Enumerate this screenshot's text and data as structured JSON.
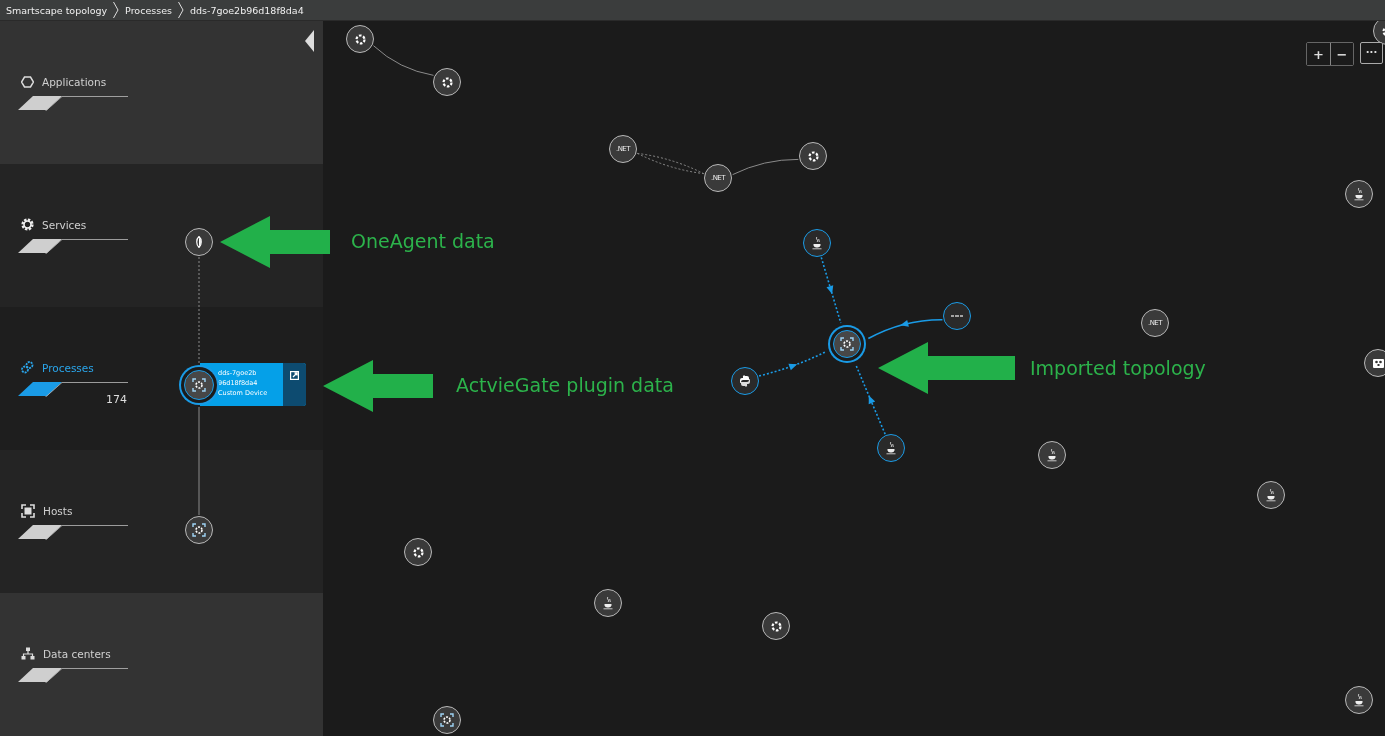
{
  "breadcrumbs": [
    "Smartscape topology",
    "Processes",
    "dds-7goe2b96d18f8da4"
  ],
  "sidebar": {
    "items": [
      {
        "label": "Applications",
        "kind": "hexagon",
        "selected": false
      },
      {
        "label": "Services",
        "kind": "gear",
        "selected": false
      },
      {
        "label": "Processes",
        "kind": "links",
        "selected": true,
        "count": "174"
      },
      {
        "label": "Hosts",
        "kind": "host",
        "selected": false
      },
      {
        "label": "Data centers",
        "kind": "network",
        "selected": false
      }
    ]
  },
  "zoom_controls": [
    "+",
    "−",
    "···"
  ],
  "nodes": [
    {
      "kind": "process",
      "highlighted": false
    },
    {
      "kind": "process",
      "highlighted": false
    },
    {
      "kind": "dotnet",
      "label": ".NET",
      "highlighted": false
    },
    {
      "kind": "dotnet",
      "label": ".NET",
      "highlighted": false
    },
    {
      "kind": "process",
      "highlighted": false
    },
    {
      "kind": "java",
      "highlighted": true
    },
    {
      "kind": "jmx",
      "highlighted": true
    },
    {
      "kind": "custom",
      "highlighted": true
    },
    {
      "kind": "python",
      "highlighted": true
    },
    {
      "kind": "java",
      "highlighted": true
    },
    {
      "kind": "dotnet",
      "label": ".NET",
      "highlighted": false
    },
    {
      "kind": "java",
      "highlighted": false
    },
    {
      "kind": "device",
      "highlighted": false
    },
    {
      "kind": "java",
      "highlighted": false
    },
    {
      "kind": "java",
      "highlighted": false
    },
    {
      "kind": "process",
      "highlighted": false
    },
    {
      "kind": "java",
      "highlighted": false
    },
    {
      "kind": "process",
      "highlighted": false
    },
    {
      "kind": "host",
      "highlighted": false
    },
    {
      "kind": "java",
      "highlighted": false
    },
    {
      "kind": "service",
      "highlighted": false
    },
    {
      "kind": "host",
      "highlighted": false
    },
    {
      "kind": "process",
      "highlighted": false
    }
  ],
  "selected_entity": {
    "lines": [
      "dds-7goe2b",
      "96d18f8da4",
      "Custom Device"
    ]
  },
  "annotations": [
    {
      "text": "OneAgent data"
    },
    {
      "text": "ActvieGate plugin data"
    },
    {
      "text": "Imported topology"
    }
  ]
}
